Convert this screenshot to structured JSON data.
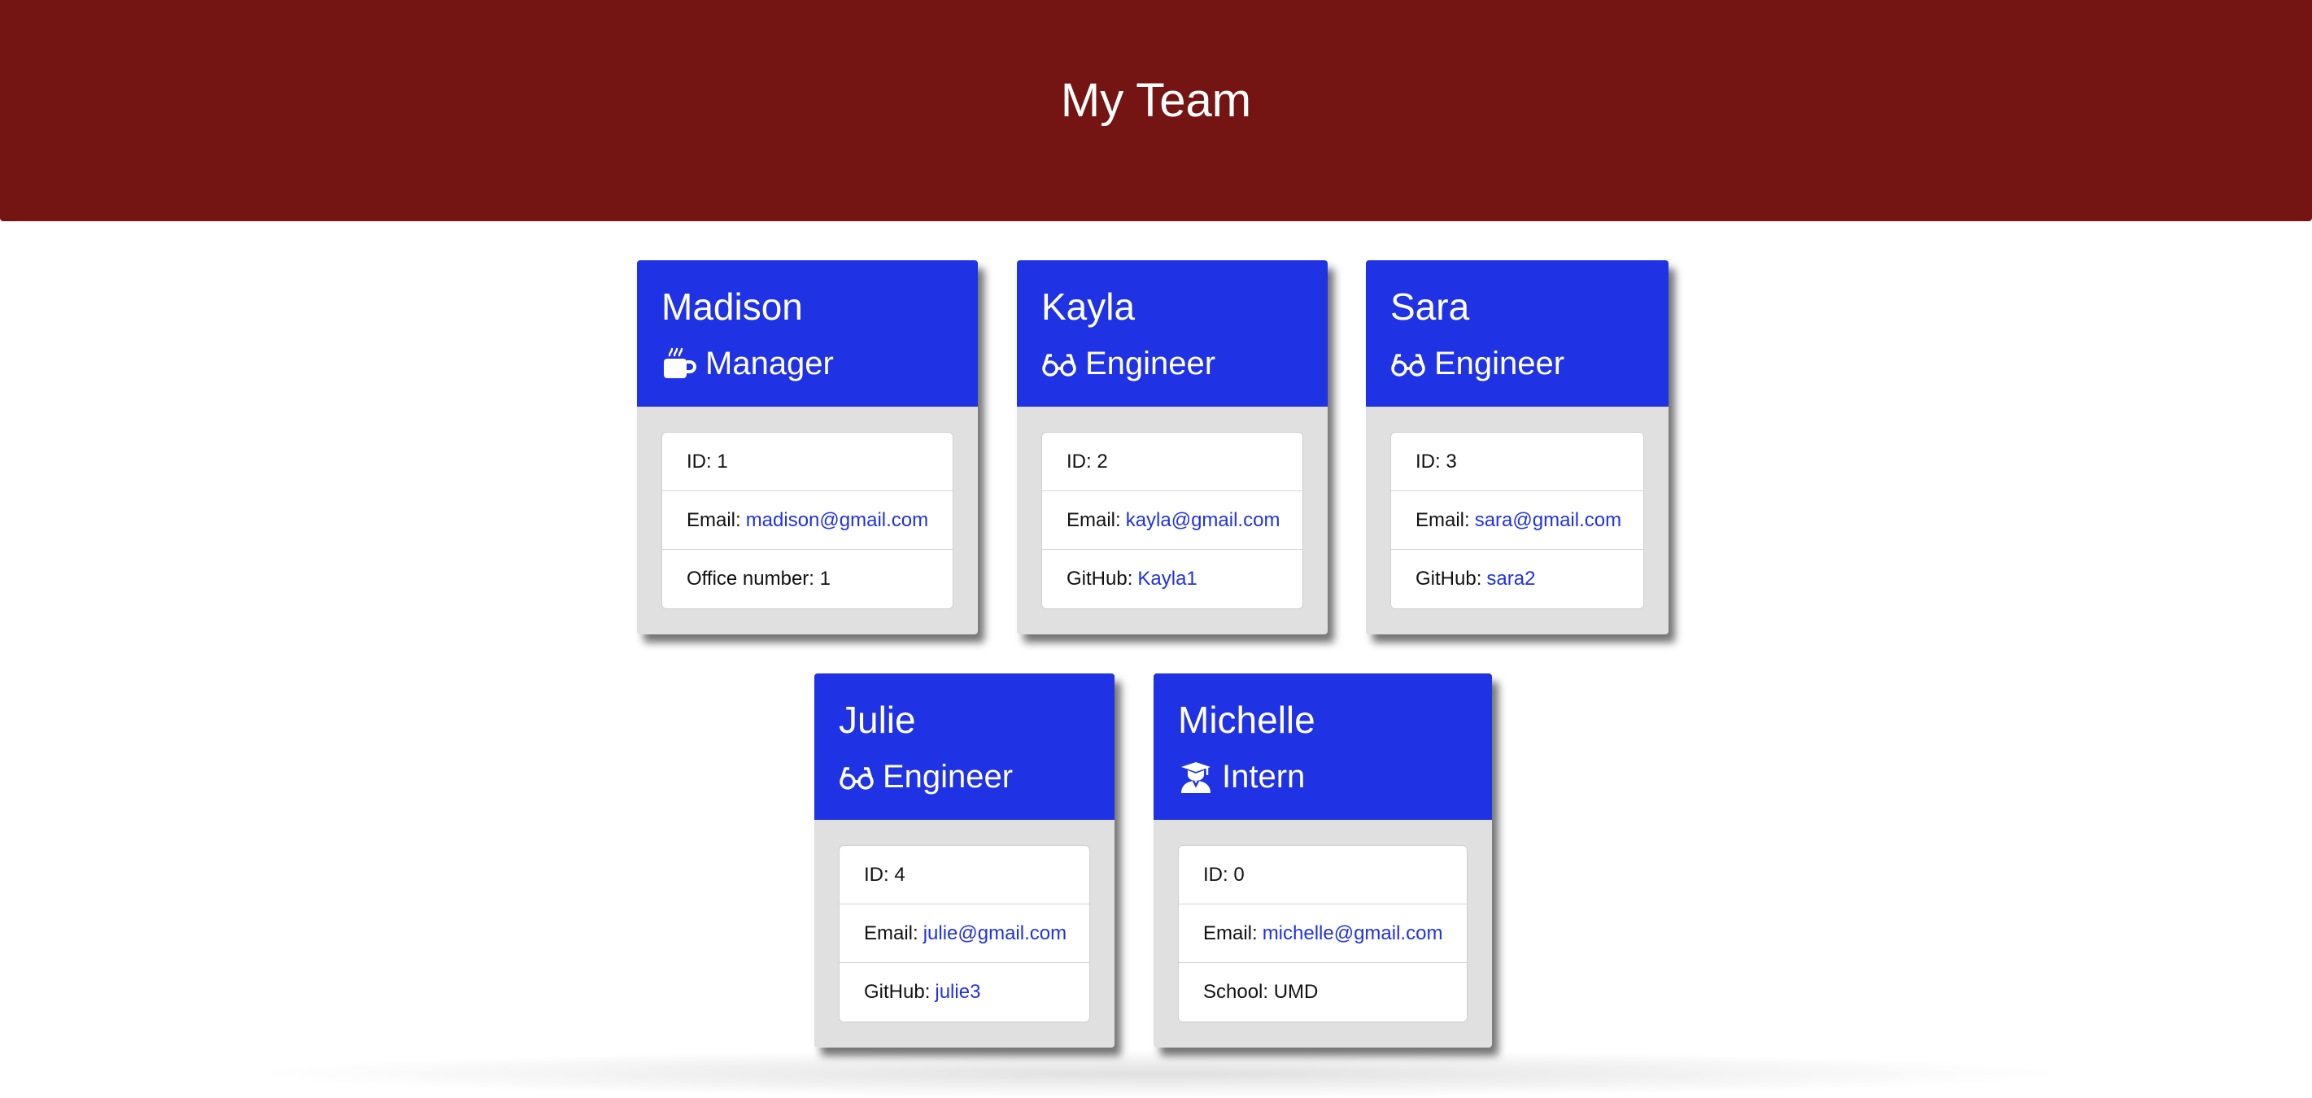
{
  "header": {
    "title": "My Team"
  },
  "cards": [
    {
      "name": "Madison",
      "role": "Manager",
      "role_icon": "coffee-mug-icon",
      "id_text": "ID: 1",
      "email_label": "Email:",
      "email": "madison@gmail.com",
      "extra_label": "Office number: 1",
      "extra_link": ""
    },
    {
      "name": "Kayla",
      "role": "Engineer",
      "role_icon": "glasses-icon",
      "id_text": "ID: 2",
      "email_label": "Email:",
      "email": "kayla@gmail.com",
      "extra_label": "GitHub:",
      "extra_link": "Kayla1"
    },
    {
      "name": "Sara",
      "role": "Engineer",
      "role_icon": "glasses-icon",
      "id_text": "ID: 3",
      "email_label": "Email:",
      "email": "sara@gmail.com",
      "extra_label": "GitHub:",
      "extra_link": "sara2"
    },
    {
      "name": "Julie",
      "role": "Engineer",
      "role_icon": "glasses-icon",
      "id_text": "ID: 4",
      "email_label": "Email:",
      "email": "julie@gmail.com",
      "extra_label": "GitHub:",
      "extra_link": "julie3"
    },
    {
      "name": "Michelle",
      "role": "Intern",
      "role_icon": "graduate-icon",
      "id_text": "ID: 0",
      "email_label": "Email:",
      "email": "michelle@gmail.com",
      "extra_label": "School: UMD",
      "extra_link": ""
    }
  ],
  "colors": {
    "header_bg": "#751513",
    "card_head_bg": "#1f32e4",
    "card_body_bg": "#e0e0e0",
    "link": "#1f32e4"
  }
}
